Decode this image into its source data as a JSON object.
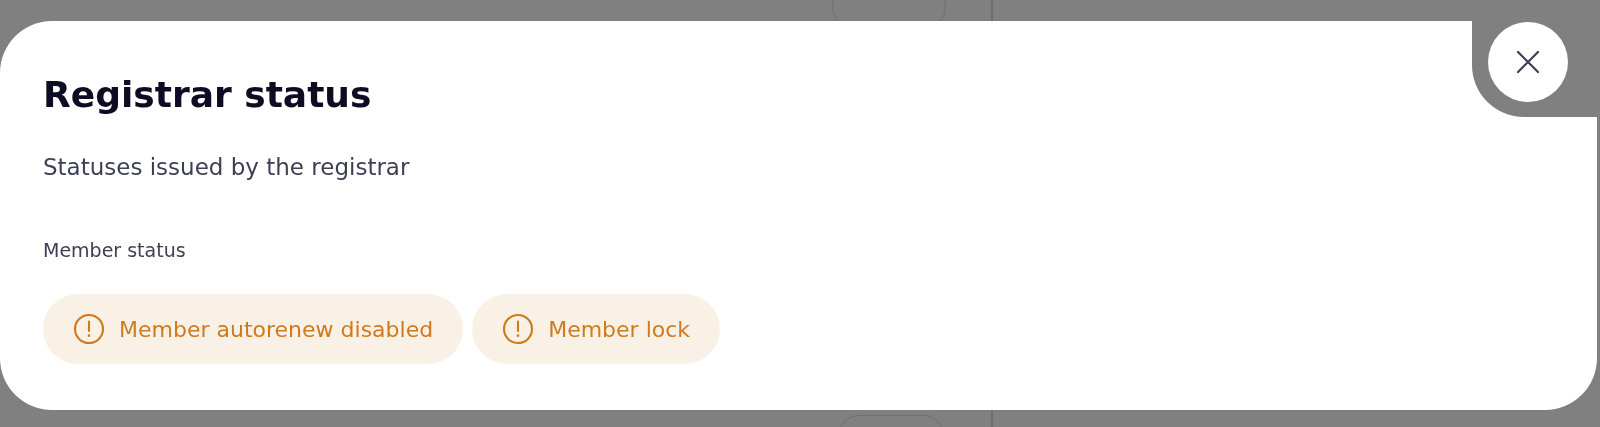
{
  "dialog": {
    "title": "Registrar status",
    "subtitle": "Statuses issued by the registrar",
    "section_label": "Member status",
    "statuses": [
      {
        "label": "Member autorenew disabled",
        "kind": "warning"
      },
      {
        "label": "Member lock",
        "kind": "warning"
      }
    ]
  }
}
